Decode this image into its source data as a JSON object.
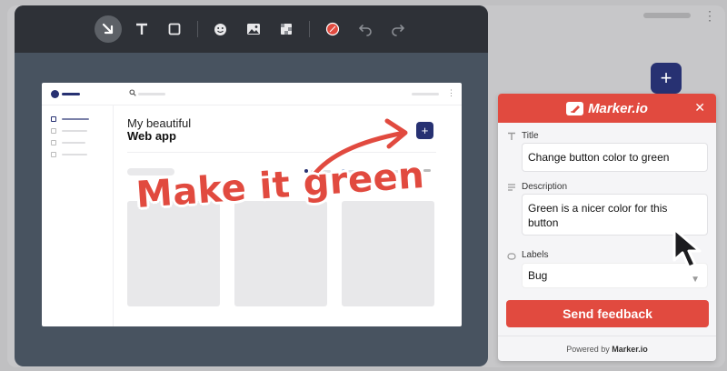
{
  "background": {
    "accent": "#273172"
  },
  "toolbar": {
    "tools": [
      "arrow-tool-icon",
      "text-tool-icon",
      "rectangle-tool-icon",
      "emoji-tool-icon",
      "image-tool-icon",
      "blur-tool-icon",
      "color-picker-icon",
      "undo-icon",
      "redo-icon"
    ],
    "active_tool": "arrow-tool-icon"
  },
  "mock_page": {
    "hero_line1": "My beautiful",
    "hero_line2": "Web app",
    "plus_label": "+"
  },
  "annotation": {
    "text": "Make it green",
    "color": "#e14a3f"
  },
  "panel": {
    "brand": "Marker.io",
    "accent": "#e14a3f",
    "title_label": "Title",
    "title_value": "Change button color to green",
    "description_label": "Description",
    "description_value": "Green is a nicer color for this button",
    "labels_label": "Labels",
    "labels_value": "Bug",
    "send_label": "Send feedback",
    "powered_prefix": "Powered by",
    "powered_brand": "Marker.io"
  }
}
